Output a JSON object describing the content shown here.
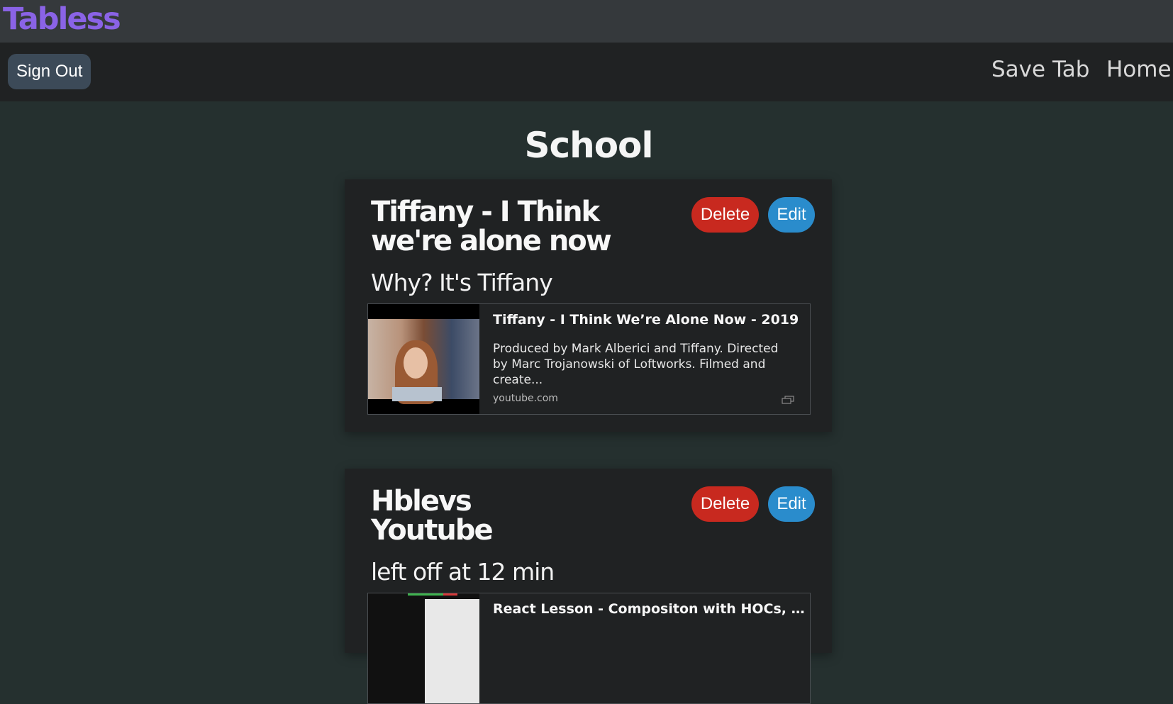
{
  "app": {
    "logo": "Tabless"
  },
  "nav": {
    "sign_out": "Sign Out",
    "save_tab": "Save Tab",
    "home": "Home"
  },
  "page": {
    "title": "School"
  },
  "cards": [
    {
      "title": "Tiffany - I Think we're alone now",
      "note": "Why? It's Tiffany",
      "delete_label": "Delete",
      "edit_label": "Edit",
      "embed": {
        "title": "Tiffany - I Think We’re Alone Now - 2019",
        "description": "Produced by Mark Alberici and Tiffany. Directed by Marc Trojanowski of Loftworks. Filmed and create...",
        "domain": "youtube.com"
      }
    },
    {
      "title": "Hblevs Youtube",
      "note": "left off at 12 min",
      "delete_label": "Delete",
      "edit_label": "Edit",
      "embed": {
        "title": "React Lesson - Compositon with HOCs, Ren..."
      }
    }
  ],
  "colors": {
    "logo": "#8a63e6",
    "delete": "#c8291f",
    "edit": "#2a8ccc",
    "background": "#25302f",
    "card": "#202223"
  }
}
